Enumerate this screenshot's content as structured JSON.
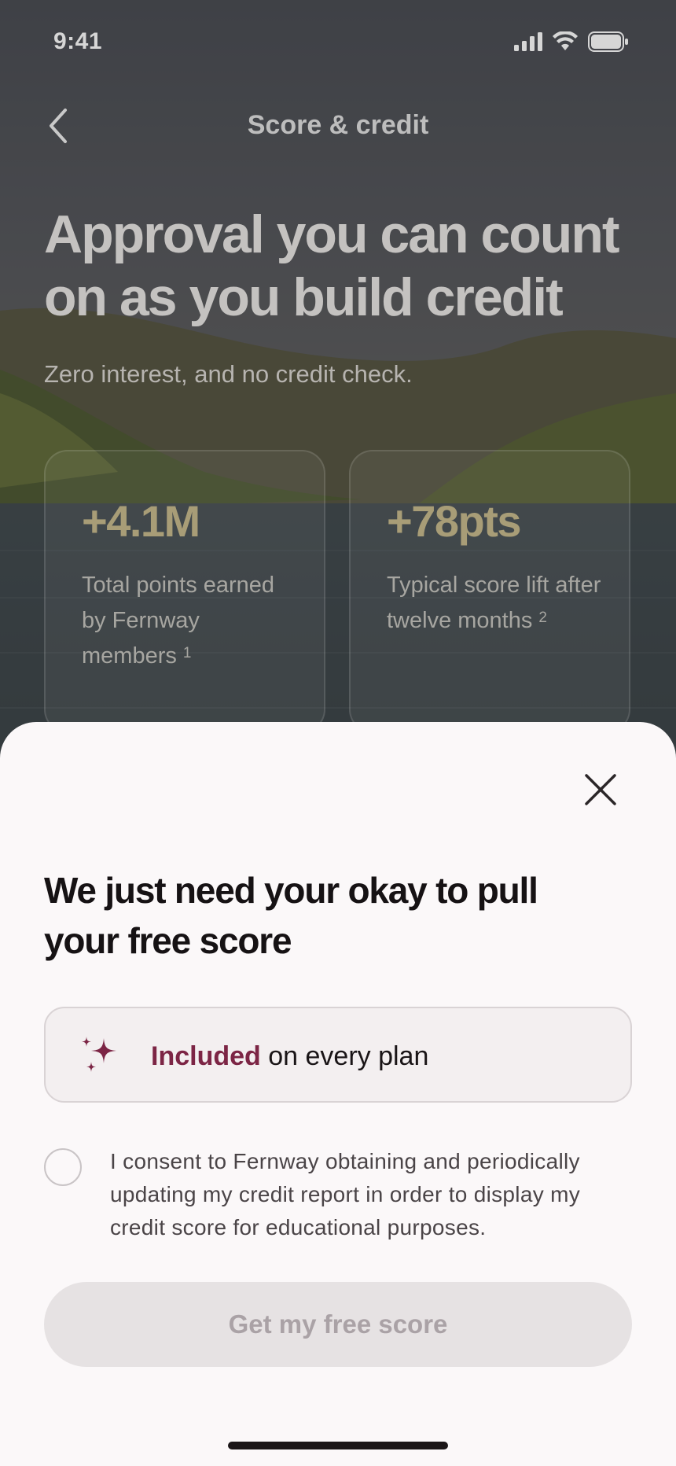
{
  "status_bar": {
    "time": "9:41"
  },
  "nav": {
    "title": "Score & credit"
  },
  "hero": {
    "headline": "Approval you can count on as you build credit",
    "subhead": "Zero interest, and no credit check."
  },
  "stats": [
    {
      "value": "+4.1M",
      "description": "Total points earned by Fernway members",
      "footnote": "1"
    },
    {
      "value": "+78pts",
      "description": "Typical score lift after twelve months",
      "footnote": "2"
    }
  ],
  "sheet": {
    "title": "We just need your okay to pull your free score",
    "plan_highlight": "Included",
    "plan_rest": " on every plan",
    "consent_text": "I consent to Fernway obtaining and periodically updating my credit report in order to display my credit score for educational purposes.",
    "consent_checked": false,
    "cta_label": "Get my free score"
  },
  "colors": {
    "accent": "#7c2545",
    "sheet_bg": "#fbf8f9",
    "cta_disabled_bg": "#e6e2e3"
  }
}
